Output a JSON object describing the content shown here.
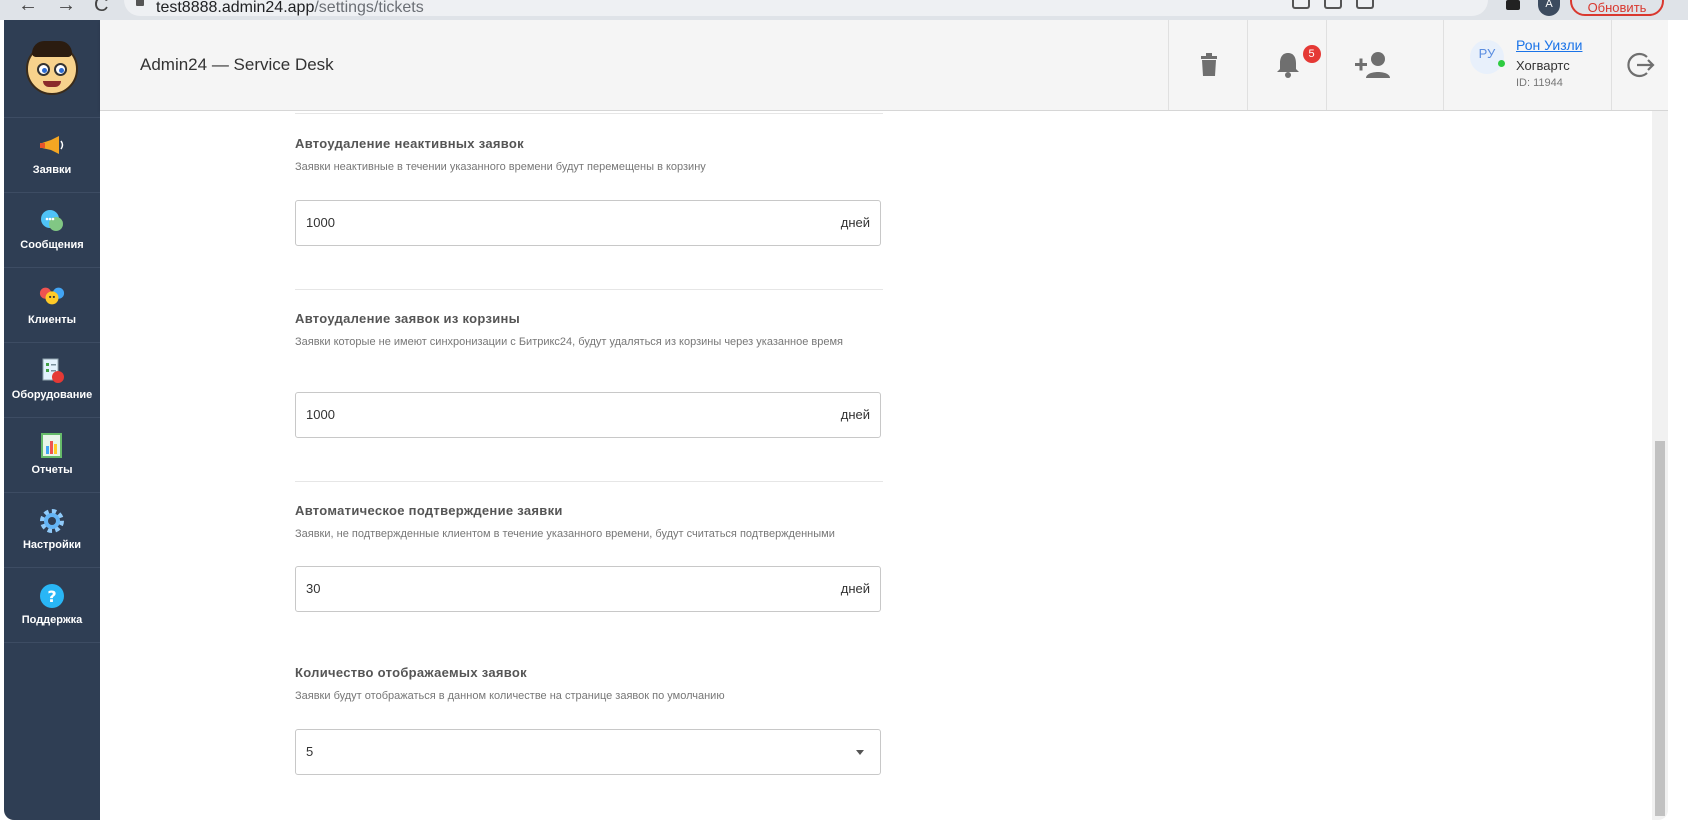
{
  "browser": {
    "url_host": "test8888.admin24.app",
    "url_path": "/settings/tickets",
    "profile_initial": "A",
    "update_label": "Обновить"
  },
  "sidebar": {
    "items": [
      {
        "label": "Заявки",
        "icon": "megaphone-icon"
      },
      {
        "label": "Сообщения",
        "icon": "chat-bubble-icon"
      },
      {
        "label": "Клиенты",
        "icon": "clients-icon"
      },
      {
        "label": "Оборудование",
        "icon": "equipment-icon"
      },
      {
        "label": "Отчеты",
        "icon": "report-icon"
      },
      {
        "label": "Настройки",
        "icon": "gear-icon"
      },
      {
        "label": "Поддержка",
        "icon": "help-icon"
      }
    ]
  },
  "header": {
    "title": "Admin24 — Service Desk",
    "notification_count": "5",
    "user": {
      "initials": "РУ",
      "name": "Рон Уизли",
      "company": "Хогвартс",
      "id": "ID: 11944"
    }
  },
  "settings": [
    {
      "title": "Автоудаление неактивных заявок",
      "description": "Заявки неактивные в течении указанного времени будут перемещены в корзину",
      "value": "1000",
      "unit": "дней"
    },
    {
      "title": "Автоудаление заявок из корзины",
      "description": "Заявки которые не имеют синхронизации с Битрикс24, будут удаляться из корзины через указанное время",
      "value": "1000",
      "unit": "дней"
    },
    {
      "title": "Автоматическое подтверждение заявки",
      "description": "Заявки, не подтвержденные клиентом в течение указанного времени, будут считаться подтвержденными",
      "value": "30",
      "unit": "дней"
    },
    {
      "title": "Количество отображаемых заявок",
      "description": "Заявки будут отображаться в данном количестве на странице заявок по умолчанию",
      "value": "5"
    }
  ],
  "colors": {
    "sidebar_bg": "#2f3e54",
    "header_bg": "#f5f5f5",
    "accent_link": "#1a73e8",
    "badge_red": "#e53935",
    "online_green": "#2ecc40"
  }
}
